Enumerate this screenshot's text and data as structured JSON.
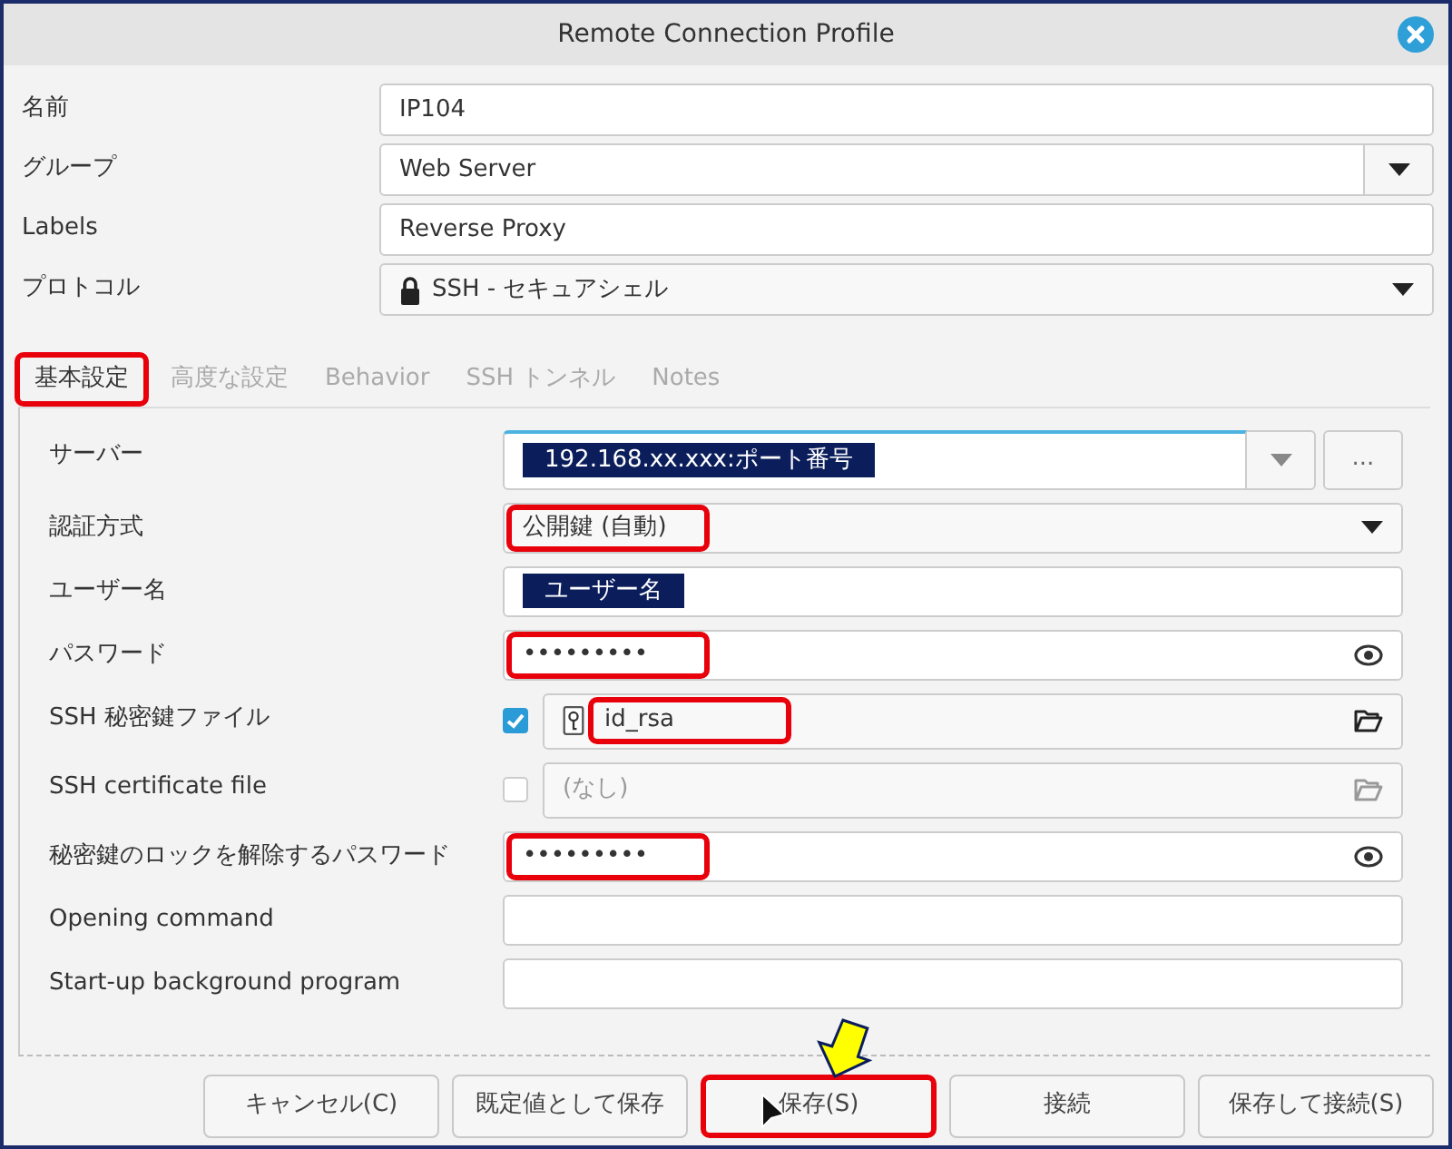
{
  "window": {
    "title": "Remote Connection Profile"
  },
  "fields": [
    {
      "label": "名前",
      "kind": "text",
      "value": "IP104"
    },
    {
      "label": "グループ",
      "kind": "combo",
      "value": "Web Server"
    },
    {
      "label": "Labels",
      "kind": "text",
      "value": "Reverse Proxy"
    },
    {
      "label": "プロトコル",
      "kind": "dropdown",
      "value": "SSH - セキュアシェル",
      "lock_icon": true
    }
  ],
  "tabs": [
    {
      "label": "基本設定",
      "selected": true,
      "highlighted": true
    },
    {
      "label": "高度な設定",
      "selected": false,
      "highlighted": false
    },
    {
      "label": "Behavior",
      "selected": false,
      "highlighted": false
    },
    {
      "label": "SSH トンネル",
      "selected": false,
      "highlighted": false
    },
    {
      "label": "Notes",
      "selected": false,
      "highlighted": false
    }
  ],
  "settings": [
    {
      "label": "サーバー",
      "kind": "server",
      "value": "192.168.xx.xxx:ポート番号",
      "text_selected": true,
      "focused": true,
      "highlighted": false,
      "extra_button": "..."
    },
    {
      "label": "認証方式",
      "kind": "dropdown",
      "value": "公開鍵 (自動)",
      "highlighted": true
    },
    {
      "label": "ユーザー名",
      "kind": "text",
      "value": "ユーザー名",
      "text_selected": true,
      "highlighted": false
    },
    {
      "label": "パスワード",
      "kind": "password",
      "value": "•••••••••",
      "highlighted": true
    },
    {
      "label": "SSH 秘密鍵ファイル",
      "kind": "file",
      "value": "id_rsa",
      "checked": true,
      "highlighted": true
    },
    {
      "label": "SSH certificate file",
      "kind": "file",
      "value": "(なし)",
      "checked": false,
      "highlighted": false
    },
    {
      "label": "秘密鍵のロックを解除するパスワード",
      "kind": "password",
      "value": "•••••••••",
      "highlighted": true
    },
    {
      "label": "Opening command",
      "kind": "text",
      "highlighted": false
    },
    {
      "label": "Start-up background program",
      "kind": "text",
      "highlighted": false
    }
  ],
  "buttons": [
    {
      "label": "キャンセル(C)",
      "highlighted": false
    },
    {
      "label": "既定値として保存",
      "highlighted": false
    },
    {
      "label": "保存(S)",
      "highlighted": true
    },
    {
      "label": "接続",
      "highlighted": false
    },
    {
      "label": "保存して接続(S)",
      "highlighted": false
    }
  ]
}
